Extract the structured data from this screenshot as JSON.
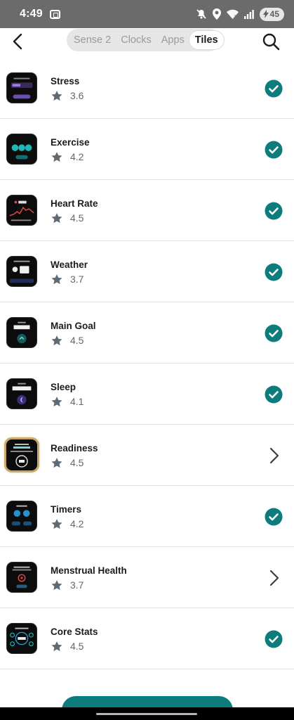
{
  "status_bar": {
    "time": "4:49",
    "battery_level": "45",
    "icons": [
      "screenshot-icon",
      "mute-icon",
      "location-icon",
      "wifi-icon",
      "signal-icon",
      "battery-icon"
    ]
  },
  "header": {
    "tabs": [
      {
        "label": "Sense 2",
        "active": false
      },
      {
        "label": "Clocks",
        "active": false
      },
      {
        "label": "Apps",
        "active": false
      },
      {
        "label": "Tiles",
        "active": true
      }
    ]
  },
  "colors": {
    "accent": "#0d7c7c",
    "star": "#5e6b75",
    "chevron": "#3d3d3d"
  },
  "tiles": [
    {
      "name": "Stress",
      "rating": "3.6",
      "status": "installed"
    },
    {
      "name": "Exercise",
      "rating": "4.2",
      "status": "installed"
    },
    {
      "name": "Heart Rate",
      "rating": "4.5",
      "status": "installed"
    },
    {
      "name": "Weather",
      "rating": "3.7",
      "status": "installed"
    },
    {
      "name": "Main Goal",
      "rating": "4.5",
      "status": "installed"
    },
    {
      "name": "Sleep",
      "rating": "4.1",
      "status": "installed"
    },
    {
      "name": "Readiness",
      "rating": "4.5",
      "status": "available"
    },
    {
      "name": "Timers",
      "rating": "4.2",
      "status": "installed"
    },
    {
      "name": "Menstrual Health",
      "rating": "3.7",
      "status": "available"
    },
    {
      "name": "Core Stats",
      "rating": "4.5",
      "status": "installed"
    }
  ]
}
